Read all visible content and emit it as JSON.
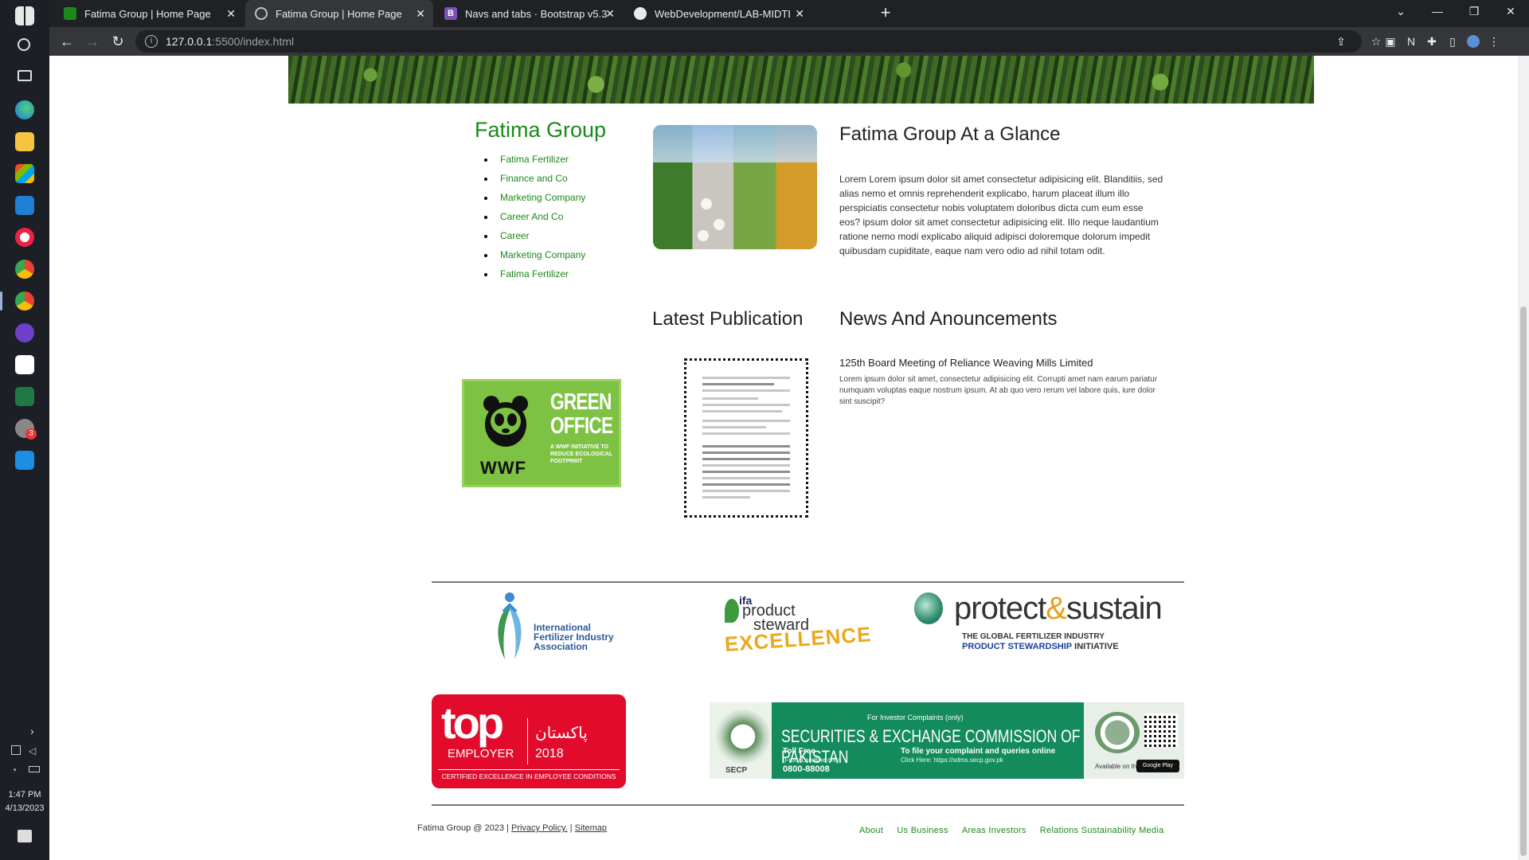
{
  "browser": {
    "tabs": [
      {
        "title": "Fatima Group | Home Page",
        "active": false
      },
      {
        "title": "Fatima Group | Home Page",
        "active": true
      },
      {
        "title": "Navs and tabs · Bootstrap v5.3",
        "active": false
      },
      {
        "title": "WebDevelopment/LAB-MIDTERM",
        "active": false
      }
    ],
    "url_host": "127.0.0.1",
    "url_rest": ":5500/index.html"
  },
  "taskbar": {
    "time": "1:47 PM",
    "date": "4/13/2023",
    "badge": "3"
  },
  "page": {
    "sidebar": {
      "title": "Fatima Group",
      "items": [
        "Fatima Fertilizer",
        "Finance and Co",
        "Marketing Company",
        "Career And Co",
        "Career",
        "Marketing Company",
        "Fatima Fertilizer"
      ]
    },
    "glance": {
      "title": "Fatima Group At a Glance",
      "text": "Lorem Lorem ipsum dolor sit amet consectetur adipisicing elit. Blanditiis, sed alias nemo et omnis reprehenderit explicabo, harum placeat illum illo perspiciatis consectetur nobis voluptatem doloribus dicta cum eum esse eos? ipsum dolor sit amet consectetur adipisicing elit. Illo neque laudantium ratione nemo modi explicabo aliquid adipisci doloremque dolorum impedit quibusdam cupiditate, eaque nam vero odio ad nihil totam odit."
    },
    "publication": {
      "title": "Latest Publication"
    },
    "news": {
      "title": "News And Anouncements",
      "headline": "125th Board Meeting of Reliance Weaving Mills Limited",
      "text": "Lorem ipsum dolor sit amet, consectetur adipisicing elit. Corrupti amet nam earum pariatur numquam voluptas eaque nostrum ipsum. At ab quo vero rerum vel labore quis, iure dolor sint suscipit?"
    },
    "wwf": {
      "brand": "WWF",
      "line1": "GREEN",
      "line2": "OFFICE",
      "sub": "A WWF INITIATIVE TO REDUCE ECOLOGICAL FOOTPRINT"
    },
    "logos": {
      "ifa": "International Fertilizer Industry Association",
      "steward": {
        "l1": "ifa",
        "l2": "product",
        "l3": "steward",
        "l4": "EXCELLENCE"
      },
      "protect": {
        "main_a": "protect",
        "amp": "&",
        "main_b": "sustain",
        "sub1": "THE GLOBAL FERTILIZER INDUSTRY",
        "sub2_bold": "PRODUCT STEWARDSHIP",
        "sub2_rest": " INITIATIVE"
      },
      "top_employer": {
        "top": "top",
        "employer": "EMPLOYER",
        "urdu": "پاکستان",
        "year": "2018",
        "cert": "CERTIFIED EXCELLENCE IN EMPLOYEE CONDITIONS"
      },
      "secp": {
        "band": "For Investor Complaints (only)",
        "title": "SECURITIES & EXCHANGE COMMISSION OF PAKISTAN",
        "toll": "Toll Free",
        "toll_sub": "(From Landline only)",
        "number": "0800-88008",
        "complaint": "To file your complaint and queries online",
        "link": "Click Here: https://sdms.secp.gov.pk",
        "label": "SECP",
        "avail": "Available on the",
        "gplay": "Google Play"
      }
    },
    "footer": {
      "copy": "Fatima Group @ 2023 |",
      "privacy": "Privacy Policy.",
      "sep": "|",
      "sitemap": "Sitemap",
      "links": [
        "About",
        "Us Business",
        "Areas Investors",
        "Relations Sustainability Media"
      ]
    }
  }
}
